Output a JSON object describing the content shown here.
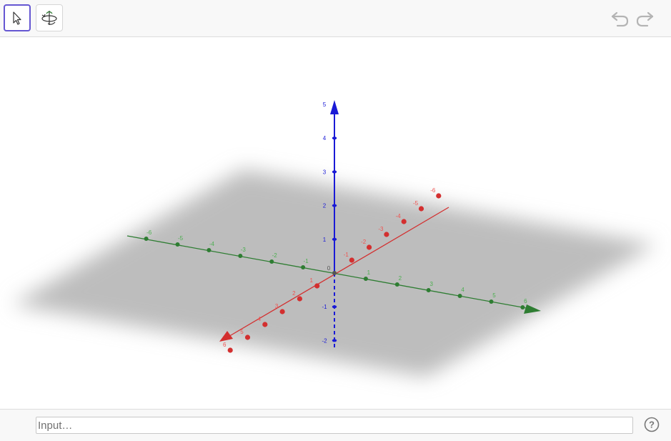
{
  "app": {
    "colors": {
      "x_axis": "#d32f2f",
      "y_axis": "#2e7d32",
      "z_axis": "#1a1ad6",
      "plane": "#bdbdbd",
      "selected_tool_border": "#6557d2"
    }
  },
  "toolbar": {
    "tools": [
      {
        "icon": "move-arrow-icon",
        "selected": true
      },
      {
        "icon": "rotate-view-icon",
        "selected": false
      }
    ],
    "undo_icon": "undo-icon",
    "redo_icon": "redo-icon"
  },
  "graphics": {
    "x_axis_ticks": [
      "-6",
      "-5",
      "-4",
      "-3",
      "-2",
      "-1",
      "1",
      "2",
      "3",
      "4",
      "5",
      "6"
    ],
    "y_axis_ticks": [
      "-6",
      "-5",
      "-4",
      "-3",
      "-2",
      "-1",
      "1",
      "2",
      "3",
      "4",
      "5",
      "6"
    ],
    "z_axis_ticks": [
      "-2",
      "-1",
      "1",
      "2",
      "3",
      "4",
      "5"
    ],
    "origin_label": "0"
  },
  "input_bar": {
    "placeholder": "Input…",
    "value": ""
  },
  "help": {
    "icon": "help-icon",
    "label": "?"
  }
}
